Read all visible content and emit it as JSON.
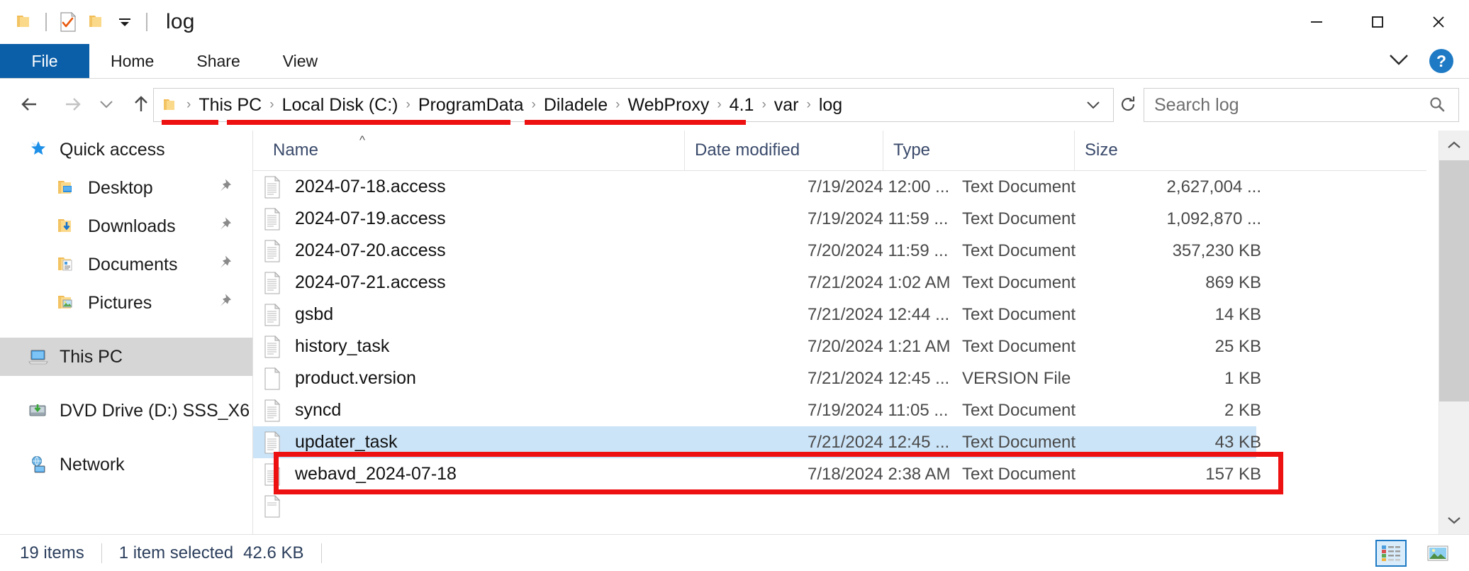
{
  "window": {
    "title": "log",
    "quick_access_toolbar": [
      {
        "icon": "folder-icon",
        "name": "qat-folder"
      },
      {
        "icon": "properties-checkmark-icon",
        "name": "qat-properties"
      },
      {
        "icon": "new-folder-icon",
        "name": "qat-new-folder"
      },
      {
        "icon": "chevron-down-icon",
        "name": "qat-customize"
      }
    ],
    "controls": {
      "minimize": "–",
      "maximize": "□",
      "close": "✕"
    }
  },
  "ribbon": {
    "tabs": [
      {
        "label": "File",
        "active": true
      },
      {
        "label": "Home",
        "active": false
      },
      {
        "label": "Share",
        "active": false
      },
      {
        "label": "View",
        "active": false
      }
    ],
    "expand_icon": "chevron-down-icon",
    "help_label": "?"
  },
  "address": {
    "back_icon": "arrow-left-icon",
    "forward_icon": "arrow-right-icon",
    "recent_icon": "chevron-down-icon",
    "up_icon": "arrow-up-icon",
    "folder_icon": "folder-icon",
    "breadcrumbs": [
      "This PC",
      "Local Disk (C:)",
      "ProgramData",
      "Diladele",
      "WebProxy",
      "4.1",
      "var",
      "log"
    ],
    "dropdown_icon": "chevron-down-icon",
    "refresh_icon": "refresh-icon"
  },
  "search": {
    "placeholder": "Search log",
    "icon": "search-icon"
  },
  "sidebar": {
    "items": [
      {
        "label": "Quick access",
        "icon": "star-pin-icon",
        "level": 0,
        "pinned": false,
        "selected": false
      },
      {
        "label": "Desktop",
        "icon": "desktop-folder-icon",
        "level": 1,
        "pinned": true,
        "selected": false
      },
      {
        "label": "Downloads",
        "icon": "downloads-folder-icon",
        "level": 1,
        "pinned": true,
        "selected": false
      },
      {
        "label": "Documents",
        "icon": "documents-folder-icon",
        "level": 1,
        "pinned": true,
        "selected": false
      },
      {
        "label": "Pictures",
        "icon": "pictures-folder-icon",
        "level": 1,
        "pinned": true,
        "selected": false
      },
      {
        "label": "This PC",
        "icon": "this-pc-icon",
        "level": 0,
        "pinned": false,
        "selected": true
      },
      {
        "label": "DVD Drive (D:) SSS_X6",
        "icon": "dvd-drive-icon",
        "level": 0,
        "pinned": false,
        "selected": false
      },
      {
        "label": "Network",
        "icon": "network-icon",
        "level": 0,
        "pinned": false,
        "selected": false
      }
    ]
  },
  "filelist": {
    "columns": [
      {
        "label": "Name",
        "sorted": true,
        "sort_dir": "asc"
      },
      {
        "label": "Date modified",
        "sorted": false
      },
      {
        "label": "Type",
        "sorted": false
      },
      {
        "label": "Size",
        "sorted": false
      }
    ],
    "rows": [
      {
        "name": "2024-07-18.access",
        "date": "7/19/2024 12:00 ...",
        "type": "Text Document",
        "size": "2,627,004 ...",
        "icon": "text-file-icon",
        "selected": false
      },
      {
        "name": "2024-07-19.access",
        "date": "7/19/2024 11:59 ...",
        "type": "Text Document",
        "size": "1,092,870 ...",
        "icon": "text-file-icon",
        "selected": false
      },
      {
        "name": "2024-07-20.access",
        "date": "7/20/2024 11:59 ...",
        "type": "Text Document",
        "size": "357,230 KB",
        "icon": "text-file-icon",
        "selected": false
      },
      {
        "name": "2024-07-21.access",
        "date": "7/21/2024 1:02 AM",
        "type": "Text Document",
        "size": "869 KB",
        "icon": "text-file-icon",
        "selected": false
      },
      {
        "name": "gsbd",
        "date": "7/21/2024 12:44 ...",
        "type": "Text Document",
        "size": "14 KB",
        "icon": "text-file-icon",
        "selected": false
      },
      {
        "name": "history_task",
        "date": "7/20/2024 1:21 AM",
        "type": "Text Document",
        "size": "25 KB",
        "icon": "text-file-icon",
        "selected": false
      },
      {
        "name": "product.version",
        "date": "7/21/2024 12:45 ...",
        "type": "VERSION File",
        "size": "1 KB",
        "icon": "blank-file-icon",
        "selected": false
      },
      {
        "name": "syncd",
        "date": "7/19/2024 11:05 ...",
        "type": "Text Document",
        "size": "2 KB",
        "icon": "text-file-icon",
        "selected": false
      },
      {
        "name": "updater_task",
        "date": "7/21/2024 12:45 ...",
        "type": "Text Document",
        "size": "43 KB",
        "icon": "text-file-icon",
        "selected": true
      },
      {
        "name": "webavd_2024-07-18",
        "date": "7/18/2024 2:38 AM",
        "type": "Text Document",
        "size": "157 KB",
        "icon": "text-file-icon",
        "selected": false
      }
    ]
  },
  "scrollbar": {
    "up_icon": "chevron-up-icon",
    "down_icon": "chevron-down-icon"
  },
  "status": {
    "item_count": "19 items",
    "selection": "1 item selected",
    "selection_size": "42.6 KB",
    "view_buttons": [
      {
        "name": "details-view-button",
        "icon": "details-view-icon",
        "active": true
      },
      {
        "name": "thumbnail-view-button",
        "icon": "thumbnail-view-icon",
        "active": false
      }
    ]
  },
  "annotations": {
    "accent_color": "#ee1111",
    "underline_breadcrumbs": [
      "This PC",
      "Local Disk (C:) ProgramData",
      "WebProxy 4.1 var log"
    ],
    "highlight_row": "updater_task"
  }
}
